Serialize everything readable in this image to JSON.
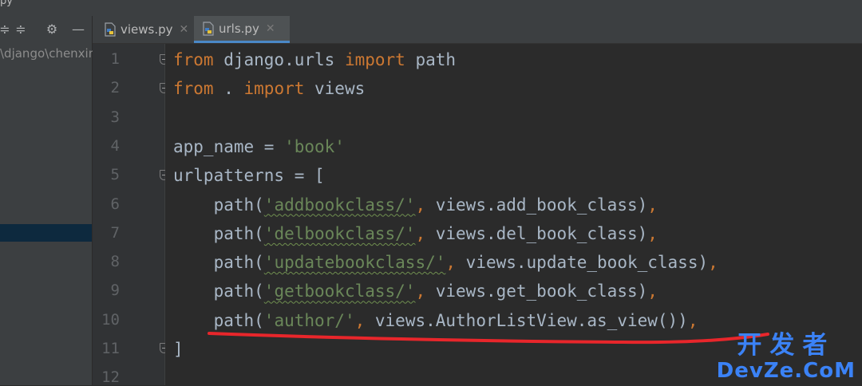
{
  "window": {
    "title_fragment": "py"
  },
  "project_panel": {
    "path_text": "\\django\\chenxin",
    "icons": [
      "collapse-icon",
      "expand-icon",
      "gear-icon",
      "minimize-icon"
    ]
  },
  "tabs": [
    {
      "label": "views.py",
      "active": false
    },
    {
      "label": "urls.py",
      "active": true
    }
  ],
  "editor": {
    "line_numbers": [
      "1",
      "2",
      "3",
      "4",
      "5",
      "6",
      "7",
      "8",
      "9",
      "10",
      "11",
      "12"
    ],
    "lines": [
      {
        "tokens": [
          {
            "t": "from",
            "c": "kw"
          },
          {
            "t": " django.urls ",
            "c": ""
          },
          {
            "t": "import",
            "c": "kw"
          },
          {
            "t": " path",
            "c": ""
          }
        ]
      },
      {
        "tokens": [
          {
            "t": "from",
            "c": "kw"
          },
          {
            "t": " . ",
            "c": ""
          },
          {
            "t": "import",
            "c": "kw"
          },
          {
            "t": " views",
            "c": ""
          }
        ]
      },
      {
        "tokens": []
      },
      {
        "tokens": [
          {
            "t": "app_name = ",
            "c": ""
          },
          {
            "t": "'book'",
            "c": "str"
          }
        ]
      },
      {
        "tokens": [
          {
            "t": "urlpatterns = [",
            "c": ""
          }
        ]
      },
      {
        "tokens": [
          {
            "t": "    path(",
            "c": ""
          },
          {
            "t": "'addbookclass/'",
            "c": "str sq"
          },
          {
            "t": ",",
            "c": "kw"
          },
          {
            "t": " views.add_book_class)",
            "c": ""
          },
          {
            "t": ",",
            "c": "kw"
          }
        ]
      },
      {
        "tokens": [
          {
            "t": "    path(",
            "c": ""
          },
          {
            "t": "'delbookclass/'",
            "c": "str sq"
          },
          {
            "t": ",",
            "c": "kw"
          },
          {
            "t": " views.del_book_class)",
            "c": ""
          },
          {
            "t": ",",
            "c": "kw"
          }
        ]
      },
      {
        "tokens": [
          {
            "t": "    path(",
            "c": ""
          },
          {
            "t": "'updatebookclass/'",
            "c": "str sq"
          },
          {
            "t": ",",
            "c": "kw"
          },
          {
            "t": " views.update_book_class)",
            "c": ""
          },
          {
            "t": ",",
            "c": "kw"
          }
        ]
      },
      {
        "tokens": [
          {
            "t": "    path(",
            "c": ""
          },
          {
            "t": "'getbookclass/'",
            "c": "str sq"
          },
          {
            "t": ",",
            "c": "kw"
          },
          {
            "t": " views.get_book_class)",
            "c": ""
          },
          {
            "t": ",",
            "c": "kw"
          }
        ]
      },
      {
        "tokens": [
          {
            "t": "    path(",
            "c": ""
          },
          {
            "t": "'author/'",
            "c": "str"
          },
          {
            "t": ",",
            "c": "kw"
          },
          {
            "t": " views.AuthorListView.as_view())",
            "c": ""
          },
          {
            "t": ",",
            "c": "kw"
          }
        ]
      },
      {
        "tokens": [
          {
            "t": "]",
            "c": ""
          }
        ]
      },
      {
        "tokens": []
      }
    ]
  },
  "watermark": {
    "cn": "开发者",
    "en": "DevZe.CoM"
  },
  "colors": {
    "keyword": "#cc7832",
    "string": "#6a8759",
    "default": "#a9b7c6",
    "annotation": "#e8262b",
    "watermark": "#3b82f6"
  }
}
